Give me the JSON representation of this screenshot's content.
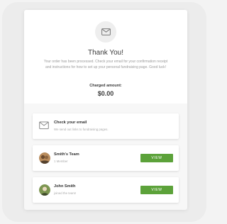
{
  "header": {
    "title": "Thank You!",
    "message": "Your order has been processed. Check your email for your confirmation receipt and instructions for how to set up your personal fundraising page. Good luck!",
    "charged_label": "Charged amount:",
    "charged_amount": "$0.00",
    "icon": "mail-icon"
  },
  "email_notice": {
    "title": "Check your email",
    "subtitle": "We send out links to fundraising pages.",
    "icon": "mail-icon"
  },
  "team": {
    "name": "Smith's Team",
    "subtitle": "1 Member",
    "button_label": "VIEW"
  },
  "member": {
    "name": "John Smith",
    "subtitle": "joined the team!",
    "button_label": "VIEW"
  },
  "colors": {
    "accent_green": "#5ca23a",
    "card_bg": "#ffffff",
    "page_bg": "#ececec"
  }
}
